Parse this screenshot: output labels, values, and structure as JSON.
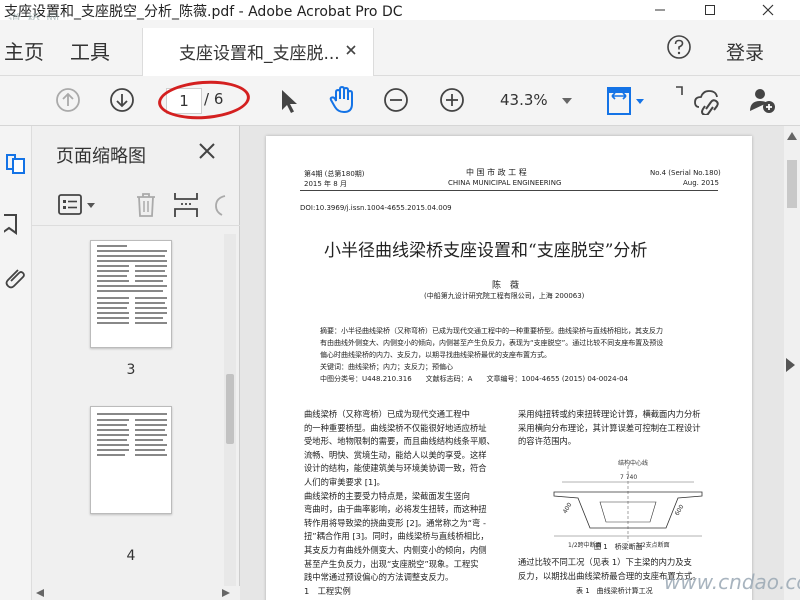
{
  "window": {
    "title": "支座设置和_支座脱空_分析_陈薇.pdf - Adobe Acrobat Pro DC",
    "watermark": "道 桥 网"
  },
  "menu": {
    "home": "主页",
    "tools": "工具",
    "tab_label": "支座设置和_支座脱...",
    "signin": "登录"
  },
  "toolbar": {
    "page_current": "1",
    "page_total": "/ 6",
    "zoom": "43.3%"
  },
  "thumbnails": {
    "title": "页面缩略图",
    "pages": [
      {
        "num": "3"
      },
      {
        "num": "4"
      }
    ]
  },
  "document": {
    "header_left_1": "第4期 (总第180期)",
    "header_left_2": "2015 年 8 月",
    "header_center_1": "中 国 市 政 工 程",
    "header_center_2": "CHINA MUNICIPAL ENGINEERING",
    "header_right_1": "No.4 (Serial No.180)",
    "header_right_2": "Aug. 2015",
    "doi": "DOI:10.3969/j.issn.1004-4655.2015.04.009",
    "title": "小半径曲线梁桥支座设置和“支座脱空”分析",
    "author": "陈　薇",
    "affiliation": "(中船第九设计研究院工程有限公司，上海 200063)",
    "abstract": [
      "摘要：小半径曲线梁桥（又称弯桥）已成为现代交通工程中的一种重要桥型。曲线梁桥与直线桥相比，其支反力",
      "有由曲线外侧变大、内侧变小的倾向，内侧甚至产生负反力，表现为“支座脱空”。通过比较不同支座布置及预设",
      "偏心时曲线梁桥的内力、支反力，以期寻找曲线梁桥最优的支座布置方式。"
    ],
    "keywords": "关键词：曲线梁桥；内力；支反力；预偏心",
    "classification": "中图分类号：U448.210.316　　文献标志码：A　　文章编号：1004-4655 (2015) 04-0024-04",
    "col_left": [
      "曲线梁桥（又称弯桥）已成为现代交通工程中",
      "的一种重要桥型。曲线梁桥不仅能很好地适应桥址",
      "受地形、地物限制的需要，而且曲线结构线条平顺、",
      "流畅、明快、赏境生动，能给人以美的享受。这样",
      "设计的结构，能使建筑美与环境美协调一致，符合",
      "人们的审美要求 [1]。",
      "曲线梁桥的主要受力特点是，梁截面发生竖向",
      "弯曲时，由于曲率影响，必将发生扭转，而这种扭",
      "转作用将导致梁的挠曲变形 [2]。通常称之为“弯 -",
      "扭”耦合作用 [3]。同时，曲线梁桥与直线桥相比，",
      "其支反力有曲线外侧变大、内侧变小的倾向，内侧",
      "甚至产生负反力，出现“支座脱空”现象。工程实",
      "践中常通过预设偏心的方法调整支反力。",
      "1　工程实例"
    ],
    "col_right": [
      "采用纯扭转或约束扭转理论计算，横截面内力分析",
      "采用横向分布理论，其计算误差可控制在工程设计",
      "的容许范围内。"
    ],
    "figure_label_top": "结构中心线",
    "figure_dim_top": "7 740",
    "figure_dim_left": "400",
    "figure_dim_right": "600",
    "figure_label_left": "1/2跨中断面",
    "figure_label_right": "1/2支点断面",
    "figure_caption": "图 1　桥梁断面",
    "col_right_2": [
      "通过比较不同工况（见表 1）下主梁的内力及支",
      "反力，以期找出曲线梁桥最合理的支座布置方式。"
    ],
    "table_caption": "表 1　曲线梁桥计算工况"
  },
  "footer_watermark": "www.cndao.com",
  "colors": {
    "accent": "#1473e6",
    "annotation": "#d42020"
  }
}
